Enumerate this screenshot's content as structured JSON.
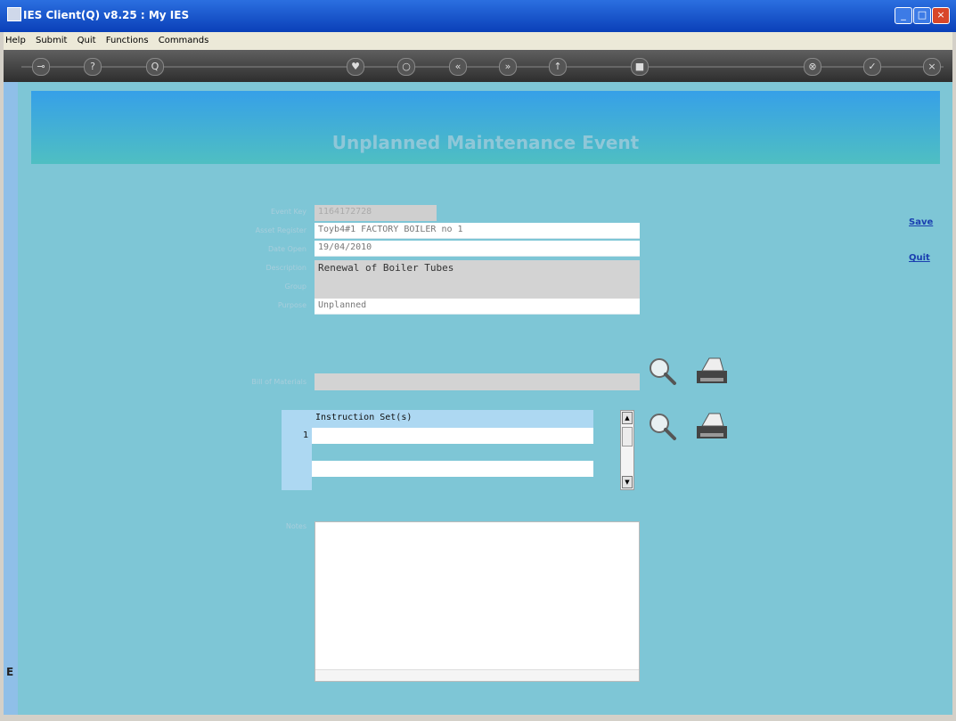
{
  "window": {
    "title": "IES Client(Q) v8.25 : My IES",
    "controls": [
      "minimize",
      "maximize",
      "close"
    ]
  },
  "menu": [
    "Help",
    "Submit",
    "Quit",
    "Functions",
    "Commands"
  ],
  "toolbar": {
    "buttons": [
      {
        "icon": "key-icon",
        "glyph": "⊸"
      },
      {
        "icon": "help-icon",
        "glyph": "?"
      },
      {
        "icon": "search-icon",
        "glyph": "Q"
      },
      {
        "icon": "heart-icon",
        "glyph": "♥"
      },
      {
        "icon": "refresh-icon",
        "glyph": "○"
      },
      {
        "icon": "back-icon",
        "glyph": "«"
      },
      {
        "icon": "forward-icon",
        "glyph": "»"
      },
      {
        "icon": "up-icon",
        "glyph": "↑"
      },
      {
        "icon": "stop-icon",
        "glyph": "■"
      },
      {
        "icon": "cancel-icon",
        "glyph": "⊗"
      },
      {
        "icon": "check-icon",
        "glyph": "✓"
      },
      {
        "icon": "close-icon",
        "glyph": "×"
      }
    ]
  },
  "page": {
    "heading": "Unplanned Maintenance Event",
    "actions": {
      "save": "Save",
      "quit": "Quit"
    }
  },
  "form": {
    "event_key": {
      "label": "Event Key",
      "value": "1164172728"
    },
    "asset_register": {
      "label": "Asset Register",
      "value": "Toyb4#1 FACTORY BOILER no 1"
    },
    "date_open": {
      "label": "Date Open",
      "value": "19/04/2010"
    },
    "description": {
      "label": "Description",
      "value": "Renewal of Boiler Tubes"
    },
    "group": {
      "label": "Group",
      "value": ""
    },
    "purpose": {
      "label": "Purpose",
      "value": "Unplanned"
    },
    "bill_of_materials": {
      "label": "Bill of Materials",
      "value": ""
    },
    "notes": {
      "label": "Notes",
      "value": ""
    }
  },
  "instruction_grid": {
    "header": "Instruction Set(s)",
    "rows": [
      {
        "num": "1",
        "value": ""
      },
      {
        "num": "",
        "value": ""
      }
    ]
  },
  "left_strip": {
    "mark": "E"
  }
}
